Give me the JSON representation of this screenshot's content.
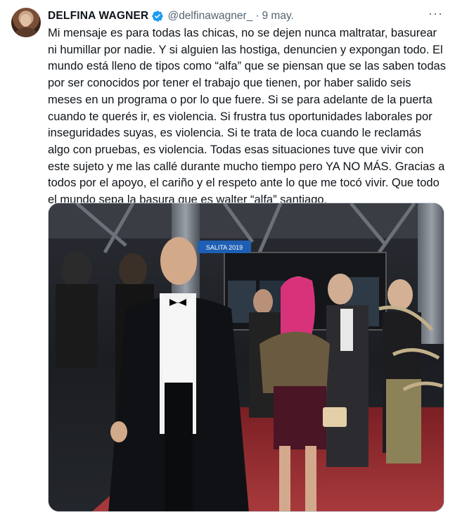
{
  "tweet": {
    "author": {
      "display_name": "DELFINA WAGNER",
      "handle": "@delfinawagner_",
      "verified": true,
      "verified_color": "#1d9bf0",
      "avatar_icon": "profile-photo"
    },
    "separator": "·",
    "date": "9 may.",
    "more_icon": "more-horizontal-icon",
    "more_glyph": "···",
    "text": "Mi mensaje es para todas las chicas, no se dejen nunca maltratar, basurear ni humillar por nadie. Y si alguien las hostiga, denuncien y expongan todo. El mundo está lleno de tipos como “alfa” que se piensan que se las saben todas por ser conocidos por tener el trabajo que tienen, por haber salido seis meses en un programa o por lo que fuere. Si se para adelante de la puerta cuando te querés ir, es violencia. Si frustra tus oportunidades laborales por inseguridades suyas, es violencia. Si te trata de loca cuando le reclamás algo con pruebas, es violencia. Todas esas situaciones tuve que vivir con este sujeto y me las callé durante mucho tiempo pero YA NO MÁS. Gracias a todos por el apoyo, el cariño y el respeto ante lo que me tocó vivir. Que todo el mundo sepa la basura que es walter “alfa” santiago.",
    "media": {
      "type": "photo",
      "sign_text": "SALITA 2019"
    }
  }
}
